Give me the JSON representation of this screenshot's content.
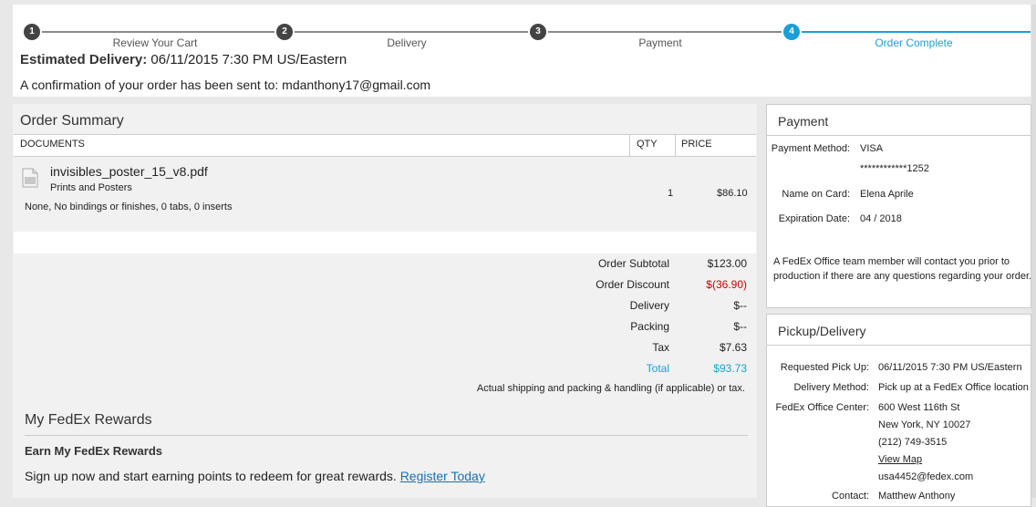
{
  "steps": [
    {
      "num": "1",
      "label": "Review Your Cart"
    },
    {
      "num": "2",
      "label": "Delivery"
    },
    {
      "num": "3",
      "label": "Payment"
    },
    {
      "num": "4",
      "label": "Order Complete"
    }
  ],
  "header": {
    "est_label": "Estimated Delivery:",
    "est_value": "06/11/2015 7:30 PM US/Eastern",
    "conf_text": "A confirmation of your order has been sent to:",
    "conf_email": "mdanthony17@gmail.com"
  },
  "order_summary": {
    "title": "Order Summary",
    "columns": {
      "documents": "DOCUMENTS",
      "qty": "QTY",
      "price": "PRICE"
    },
    "item": {
      "filename": "invisibles_poster_15_v8.pdf",
      "type": "Prints and Posters",
      "options": "None, No bindings or finishes, 0 tabs, 0 inserts",
      "qty": "1",
      "price": "$86.10"
    },
    "totals": [
      {
        "label": "Order Subtotal",
        "value": "$123.00"
      },
      {
        "label": "Order Discount",
        "value": "$(36.90)"
      },
      {
        "label": "Delivery",
        "value": "$--"
      },
      {
        "label": "Packing",
        "value": "$--"
      },
      {
        "label": "Tax",
        "value": "$7.63"
      },
      {
        "label": "Total",
        "value": "$93.73"
      }
    ],
    "note": "Actual shipping and packing & handling (if applicable) or tax."
  },
  "rewards": {
    "title": "My FedEx Rewards",
    "subtitle": "Earn My FedEx Rewards",
    "text": "Sign up now and start earning points to redeem for great rewards.",
    "link": "Register Today"
  },
  "payment": {
    "title": "Payment",
    "method_label": "Payment Method:",
    "method_value": "VISA",
    "card_number": "************1252",
    "name_label": "Name on Card:",
    "name_value": "Elena Aprile",
    "exp_label": "Expiration Date:",
    "exp_value": "04 / 2018",
    "note_line1": "A FedEx Office team member will contact you prior to",
    "note_line2": "production if there are any questions regarding your order."
  },
  "pickup": {
    "title": "Pickup/Delivery",
    "req_label": "Requested Pick Up:",
    "req_value": "06/11/2015 7:30 PM US/Eastern",
    "method_label": "Delivery Method:",
    "method_value": "Pick up at a FedEx Office location",
    "center_label": "FedEx Office Center:",
    "center_lines": [
      "600 West 116th St",
      "New York, NY 10027",
      "(212) 749-3515"
    ],
    "map_link": "View Map",
    "center_email": "usa4452@fedex.com",
    "contact_label": "Contact:",
    "contact_value": "Matthew Anthony"
  },
  "colors": {
    "accent": "#1aa0d8",
    "discount": "#cc0000",
    "link": "#1a6fb0"
  }
}
